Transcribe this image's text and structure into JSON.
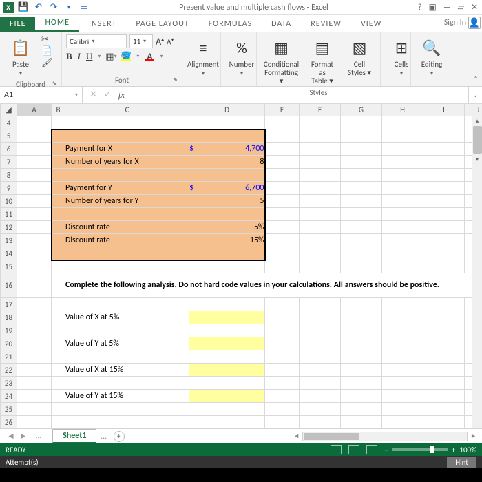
{
  "app": {
    "title": "Present value and multiple cash flows - Excel"
  },
  "window_controls": {
    "help": "?",
    "restore": "▣",
    "min": "—",
    "max": "▱",
    "close": "✕"
  },
  "qat": {
    "save": "💾",
    "undo": "↶",
    "redo": "↷",
    "custom": "▾",
    "more": "＝"
  },
  "tabs": {
    "file": "FILE",
    "home": "HOME",
    "insert": "INSERT",
    "pagelayout": "PAGE LAYOUT",
    "formulas": "FORMULAS",
    "data": "DATA",
    "review": "REVIEW",
    "view": "VIEW",
    "signin": "Sign In"
  },
  "ribbon": {
    "clipboard": {
      "paste": "Paste",
      "label": "Clipboard"
    },
    "font": {
      "name": "Calibri",
      "size": "11",
      "label": "Font",
      "bold": "B",
      "italic": "I",
      "underline": "U",
      "incA": "A",
      "decA": "A"
    },
    "alignment": {
      "label": "Alignment"
    },
    "number": {
      "label": "Number",
      "pct": "%"
    },
    "styles": {
      "cf": "Conditional",
      "cf2": "Formatting",
      "fat": "Format as",
      "fat2": "Table",
      "cs": "Cell",
      "cs2": "Styles",
      "label": "Styles"
    },
    "cells": {
      "label": "Cells"
    },
    "editing": {
      "label": "Editing",
      "find": "🔍"
    }
  },
  "namebox": "A1",
  "cols": [
    "A",
    "B",
    "C",
    "D",
    "E",
    "F",
    "G",
    "H",
    "I",
    "J"
  ],
  "rows": {
    "start": 4,
    "end": 26
  },
  "sheet": {
    "c6": "Payment for X",
    "d6s": "$",
    "d6": "4,700",
    "c7": "Number of years for X",
    "d7": "8",
    "c9": "Payment for Y",
    "d9s": "$",
    "d9": "6,700",
    "c10": "Number of years for Y",
    "d10": "5",
    "c12": "Discount rate",
    "d12": "5%",
    "c13": "Discount rate",
    "d13": "15%",
    "instr": "Complete the following analysis. Do not hard code values in your calculations. All answers should be positive.",
    "c18": "Value of X at 5%",
    "c20": "Value of Y at 5%",
    "c22": "Value of X at 15%",
    "c24": "Value of Y at 15%"
  },
  "sheettab": "Sheet1",
  "status": {
    "ready": "READY",
    "attempts": "Attempt(s)",
    "zoom": "100%",
    "hint": "Hint"
  }
}
